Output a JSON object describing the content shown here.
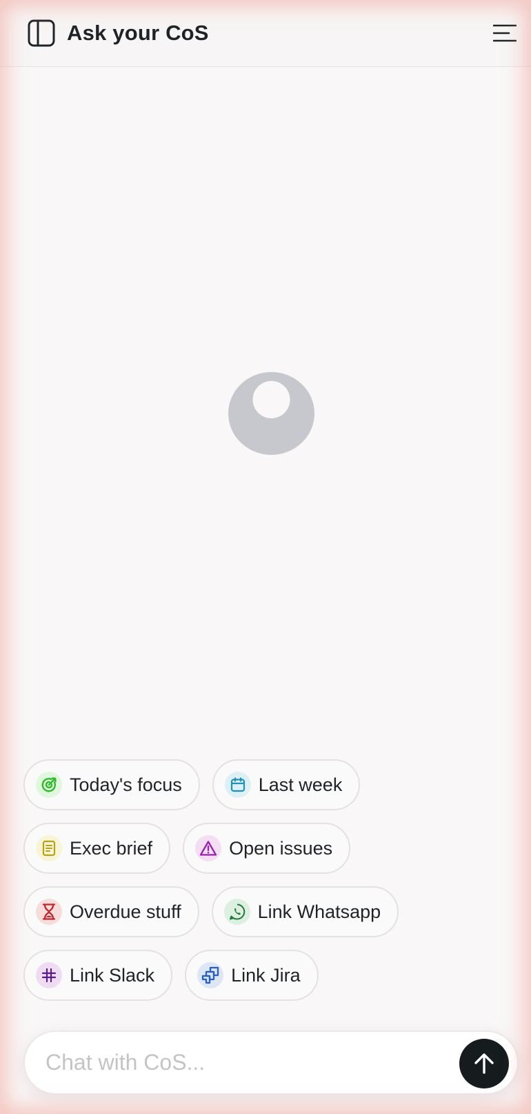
{
  "header": {
    "title": "Ask your CoS",
    "sidebar_icon": "sidebar-panel-icon",
    "menu_icon": "hamburger-menu-icon"
  },
  "avatar": {
    "icon": "user-avatar-icon",
    "color": "#c6c8cd"
  },
  "suggestions": [
    {
      "label": "Today's focus",
      "icon": "target-icon",
      "bg": "#dff7dc",
      "color": "#2fb82a"
    },
    {
      "label": "Last week",
      "icon": "calendar-icon",
      "bg": "#dcf0f6",
      "color": "#1f8fb3"
    },
    {
      "label": "Exec brief",
      "icon": "document-icon",
      "bg": "#f7f5d6",
      "color": "#b5a11a"
    },
    {
      "label": "Open issues",
      "icon": "warning-icon",
      "bg": "#f3def3",
      "color": "#9a1fb0"
    },
    {
      "label": "Overdue stuff",
      "icon": "hourglass-icon",
      "bg": "#f7dcdc",
      "color": "#c0262d"
    },
    {
      "label": "Link Whatsapp",
      "icon": "whatsapp-icon",
      "bg": "#dcefe0",
      "color": "#1f7a3a"
    },
    {
      "label": "Link Slack",
      "icon": "slack-icon",
      "bg": "#efdcf3",
      "color": "#5b1a86"
    },
    {
      "label": "Link Jira",
      "icon": "jira-icon",
      "bg": "#dce6f5",
      "color": "#2a5fc0"
    }
  ],
  "composer": {
    "placeholder": "Chat with CoS...",
    "value": "",
    "send_icon": "arrow-up-icon"
  }
}
